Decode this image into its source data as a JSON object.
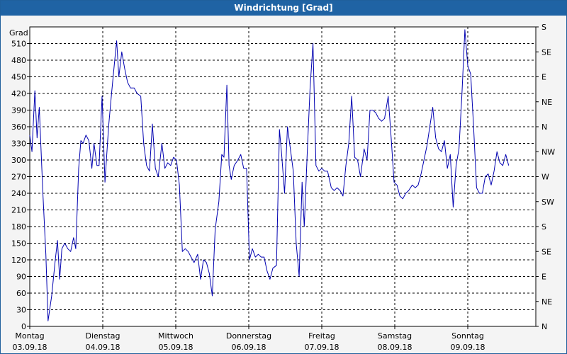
{
  "window": {
    "title": "Windrichtung [Grad]"
  },
  "chart_data": {
    "type": "line",
    "title": "Windrichtung [Grad]",
    "ylabel": "Grad",
    "ylim": [
      0,
      540
    ],
    "xlim": [
      0,
      7
    ],
    "y_ticks": [
      0,
      30,
      60,
      90,
      120,
      150,
      180,
      210,
      240,
      270,
      300,
      330,
      360,
      390,
      420,
      450,
      480,
      510
    ],
    "y2_ticks": [
      {
        "value": 0,
        "label": "N"
      },
      {
        "value": 45,
        "label": "NE"
      },
      {
        "value": 90,
        "label": "E"
      },
      {
        "value": 135,
        "label": "SE"
      },
      {
        "value": 180,
        "label": "S"
      },
      {
        "value": 225,
        "label": "SW"
      },
      {
        "value": 270,
        "label": "W"
      },
      {
        "value": 315,
        "label": "NW"
      },
      {
        "value": 360,
        "label": "N"
      },
      {
        "value": 405,
        "label": "NE"
      },
      {
        "value": 450,
        "label": "E"
      },
      {
        "value": 495,
        "label": "SE"
      },
      {
        "value": 540,
        "label": "S"
      }
    ],
    "x_ticks": [
      {
        "day": "Montag",
        "date": "03.09.18"
      },
      {
        "day": "Dienstag",
        "date": "04.09.18"
      },
      {
        "day": "Mittwoch",
        "date": "05.09.18"
      },
      {
        "day": "Donnerstag",
        "date": "06.09.18"
      },
      {
        "day": "Freitag",
        "date": "07.09.18"
      },
      {
        "day": "Samstag",
        "date": "08.09.18"
      },
      {
        "day": "Sonntag",
        "date": "09.09.18"
      }
    ],
    "grid": true,
    "series": [
      {
        "color": "#0000b0",
        "points": [
          [
            0.0,
            345
          ],
          [
            0.03,
            315
          ],
          [
            0.07,
            425
          ],
          [
            0.1,
            340
          ],
          [
            0.13,
            395
          ],
          [
            0.18,
            240
          ],
          [
            0.22,
            130
          ],
          [
            0.25,
            10
          ],
          [
            0.3,
            55
          ],
          [
            0.35,
            120
          ],
          [
            0.38,
            155
          ],
          [
            0.41,
            85
          ],
          [
            0.44,
            140
          ],
          [
            0.48,
            150
          ],
          [
            0.52,
            140
          ],
          [
            0.56,
            135
          ],
          [
            0.6,
            160
          ],
          [
            0.63,
            140
          ],
          [
            0.67,
            285
          ],
          [
            0.7,
            335
          ],
          [
            0.73,
            330
          ],
          [
            0.77,
            345
          ],
          [
            0.81,
            335
          ],
          [
            0.85,
            285
          ],
          [
            0.88,
            330
          ],
          [
            0.92,
            290
          ],
          [
            0.95,
            290
          ],
          [
            0.99,
            415
          ],
          [
            1.03,
            260
          ],
          [
            1.08,
            360
          ],
          [
            1.12,
            420
          ],
          [
            1.16,
            475
          ],
          [
            1.19,
            515
          ],
          [
            1.22,
            450
          ],
          [
            1.26,
            495
          ],
          [
            1.3,
            465
          ],
          [
            1.34,
            440
          ],
          [
            1.38,
            430
          ],
          [
            1.43,
            430
          ],
          [
            1.47,
            420
          ],
          [
            1.52,
            415
          ],
          [
            1.56,
            330
          ],
          [
            1.6,
            290
          ],
          [
            1.64,
            280
          ],
          [
            1.68,
            365
          ],
          [
            1.72,
            285
          ],
          [
            1.76,
            270
          ],
          [
            1.81,
            330
          ],
          [
            1.85,
            285
          ],
          [
            1.89,
            295
          ],
          [
            1.93,
            290
          ],
          [
            1.97,
            305
          ],
          [
            2.01,
            300
          ],
          [
            2.05,
            255
          ],
          [
            2.09,
            135
          ],
          [
            2.13,
            140
          ],
          [
            2.17,
            135
          ],
          [
            2.21,
            125
          ],
          [
            2.25,
            115
          ],
          [
            2.3,
            130
          ],
          [
            2.34,
            85
          ],
          [
            2.38,
            120
          ],
          [
            2.42,
            115
          ],
          [
            2.46,
            95
          ],
          [
            2.5,
            55
          ],
          [
            2.54,
            175
          ],
          [
            2.59,
            225
          ],
          [
            2.63,
            310
          ],
          [
            2.66,
            305
          ],
          [
            2.7,
            435
          ],
          [
            2.73,
            290
          ],
          [
            2.76,
            265
          ],
          [
            2.8,
            290
          ],
          [
            2.85,
            300
          ],
          [
            2.89,
            310
          ],
          [
            2.93,
            285
          ],
          [
            2.97,
            285
          ],
          [
            3.01,
            120
          ],
          [
            3.05,
            140
          ],
          [
            3.09,
            125
          ],
          [
            3.13,
            130
          ],
          [
            3.17,
            125
          ],
          [
            3.21,
            125
          ],
          [
            3.25,
            100
          ],
          [
            3.29,
            85
          ],
          [
            3.33,
            105
          ],
          [
            3.38,
            110
          ],
          [
            3.42,
            355
          ],
          [
            3.45,
            310
          ],
          [
            3.49,
            240
          ],
          [
            3.53,
            360
          ],
          [
            3.57,
            320
          ],
          [
            3.61,
            280
          ],
          [
            3.65,
            150
          ],
          [
            3.69,
            90
          ],
          [
            3.73,
            260
          ],
          [
            3.76,
            180
          ],
          [
            3.8,
            310
          ],
          [
            3.84,
            430
          ],
          [
            3.88,
            510
          ],
          [
            3.92,
            290
          ],
          [
            3.96,
            280
          ],
          [
            4.0,
            285
          ],
          [
            4.04,
            280
          ],
          [
            4.08,
            280
          ],
          [
            4.13,
            250
          ],
          [
            4.17,
            245
          ],
          [
            4.21,
            250
          ],
          [
            4.25,
            245
          ],
          [
            4.29,
            235
          ],
          [
            4.33,
            290
          ],
          [
            4.37,
            330
          ],
          [
            4.41,
            415
          ],
          [
            4.45,
            305
          ],
          [
            4.49,
            300
          ],
          [
            4.53,
            270
          ],
          [
            4.58,
            320
          ],
          [
            4.62,
            300
          ],
          [
            4.66,
            390
          ],
          [
            4.7,
            390
          ],
          [
            4.74,
            385
          ],
          [
            4.78,
            375
          ],
          [
            4.82,
            370
          ],
          [
            4.86,
            375
          ],
          [
            4.91,
            415
          ],
          [
            4.95,
            340
          ],
          [
            4.99,
            260
          ],
          [
            5.03,
            255
          ],
          [
            5.07,
            235
          ],
          [
            5.11,
            230
          ],
          [
            5.15,
            240
          ],
          [
            5.19,
            245
          ],
          [
            5.24,
            255
          ],
          [
            5.28,
            250
          ],
          [
            5.32,
            255
          ],
          [
            5.36,
            275
          ],
          [
            5.4,
            300
          ],
          [
            5.44,
            325
          ],
          [
            5.48,
            360
          ],
          [
            5.52,
            395
          ],
          [
            5.56,
            340
          ],
          [
            5.6,
            320
          ],
          [
            5.64,
            315
          ],
          [
            5.68,
            335
          ],
          [
            5.72,
            285
          ],
          [
            5.76,
            310
          ],
          [
            5.8,
            215
          ],
          [
            5.84,
            290
          ],
          [
            5.88,
            320
          ],
          [
            5.92,
            420
          ],
          [
            5.96,
            535
          ],
          [
            6.0,
            470
          ],
          [
            6.04,
            455
          ],
          [
            6.08,
            360
          ],
          [
            6.12,
            250
          ],
          [
            6.16,
            240
          ],
          [
            6.2,
            240
          ],
          [
            6.24,
            270
          ],
          [
            6.28,
            275
          ],
          [
            6.32,
            255
          ],
          [
            6.36,
            280
          ],
          [
            6.4,
            315
          ],
          [
            6.44,
            295
          ],
          [
            6.48,
            290
          ],
          [
            6.52,
            310
          ],
          [
            6.56,
            290
          ]
        ]
      }
    ]
  }
}
